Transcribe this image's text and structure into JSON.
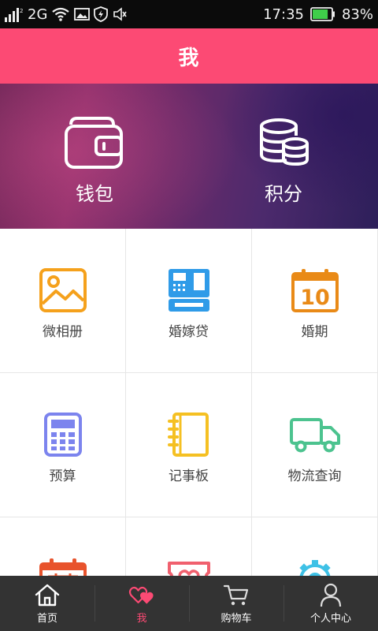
{
  "status_bar": {
    "network": "2G",
    "time": "17:35",
    "battery": "83%",
    "battery_level": 0.83,
    "icons": [
      "signal-icon",
      "wifi-icon",
      "image-icon",
      "shield-icon",
      "mute-icon",
      "battery-icon"
    ]
  },
  "header": {
    "title": "我"
  },
  "banner": {
    "wallet_label": "钱包",
    "points_label": "积分",
    "icons": [
      "wallet-icon",
      "coins-icon"
    ]
  },
  "colors": {
    "brand": "#fc4a74",
    "tabbar_bg": "#333333",
    "orange": "#f5a11c",
    "blue": "#2f9be8",
    "amber": "#e98a17",
    "violet": "#7c84ee",
    "yellow": "#f5c022",
    "green": "#4cc38f",
    "red": "#e8532c",
    "cyan": "#3ec1e6"
  },
  "grid": {
    "items": [
      {
        "label": "微相册",
        "icon": "photo-album-icon"
      },
      {
        "label": "婚嫁贷",
        "icon": "cash-register-icon"
      },
      {
        "label": "婚期",
        "icon": "calendar-icon",
        "icon_text": "10"
      },
      {
        "label": "预算",
        "icon": "calculator-icon"
      },
      {
        "label": "记事板",
        "icon": "notebook-icon"
      },
      {
        "label": "物流查询",
        "icon": "truck-icon"
      },
      {
        "label": "",
        "icon": "calendar-red-icon"
      },
      {
        "label": "",
        "icon": "heart-card-icon"
      },
      {
        "label": "",
        "icon": "gear-icon"
      }
    ]
  },
  "tabbar": {
    "tabs": [
      {
        "label": "首页",
        "icon": "home-icon",
        "active": false
      },
      {
        "label": "我",
        "icon": "hearts-icon",
        "active": true
      },
      {
        "label": "购物车",
        "icon": "cart-icon",
        "active": false
      },
      {
        "label": "个人中心",
        "icon": "person-icon",
        "active": false
      }
    ]
  }
}
